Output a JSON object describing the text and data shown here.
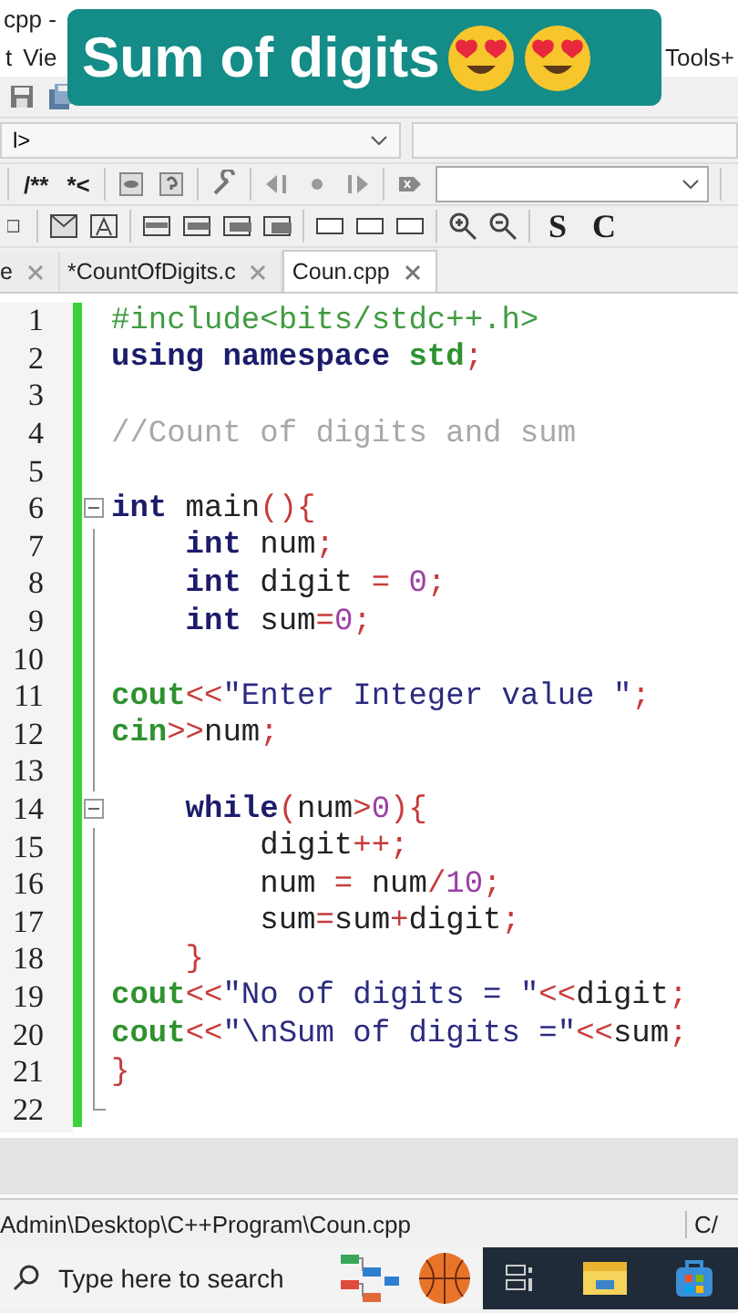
{
  "window": {
    "title": "cpp -"
  },
  "overlay_banner": {
    "title": "Sum of digits"
  },
  "menu": [
    "t",
    "Vie",
    "Tools+"
  ],
  "scope_combo": {
    "value": "l>"
  },
  "toolbar_labels": [
    "/**",
    "*<"
  ],
  "format_labels": [
    "S",
    "C"
  ],
  "tabs": [
    {
      "label": "e",
      "selected": false
    },
    {
      "label": "*CountOfDigits.c",
      "selected": false
    },
    {
      "label": "Coun.cpp",
      "selected": true
    }
  ],
  "editor": {
    "lines": [
      {
        "number": "1",
        "tokens": [
          {
            "kind": "pp",
            "t": "#include<bits/stdc++.h>"
          }
        ]
      },
      {
        "number": "2",
        "tokens": [
          {
            "kind": "kw",
            "t": "using namespace "
          },
          {
            "kind": "lib",
            "t": "std"
          },
          {
            "kind": "op",
            "t": ";"
          }
        ]
      },
      {
        "number": "3"
      },
      {
        "number": "4",
        "tokens": [
          {
            "kind": "comment",
            "t": "//Count of digits and sum"
          }
        ]
      },
      {
        "number": "5"
      },
      {
        "number": "6",
        "expanded": true,
        "tokens": [
          {
            "kind": "kw",
            "t": "int"
          },
          {
            "kind": "id",
            "t": " main"
          },
          {
            "kind": "op",
            "t": "(){"
          }
        ]
      },
      {
        "number": "7",
        "tokens": [
          {
            "kind": "kw",
            "t": "    int"
          },
          {
            "kind": "id",
            "t": " num"
          },
          {
            "kind": "op",
            "t": ";"
          }
        ]
      },
      {
        "number": "8",
        "tokens": [
          {
            "kind": "kw",
            "t": "    int"
          },
          {
            "kind": "id",
            "t": " digit "
          },
          {
            "kind": "op",
            "t": "= "
          },
          {
            "kind": "num",
            "t": "0"
          },
          {
            "kind": "op",
            "t": ";"
          }
        ]
      },
      {
        "number": "9",
        "tokens": [
          {
            "kind": "kw",
            "t": "    int"
          },
          {
            "kind": "id",
            "t": " sum"
          },
          {
            "kind": "op",
            "t": "="
          },
          {
            "kind": "num",
            "t": "0"
          },
          {
            "kind": "op",
            "t": ";"
          }
        ]
      },
      {
        "number": "10"
      },
      {
        "number": "11",
        "tokens": [
          {
            "kind": "lib",
            "t": "cout"
          },
          {
            "kind": "op",
            "t": "<<"
          },
          {
            "kind": "str",
            "t": "\"Enter Integer value \""
          },
          {
            "kind": "op",
            "t": ";"
          }
        ]
      },
      {
        "number": "12",
        "tokens": [
          {
            "kind": "lib",
            "t": "cin"
          },
          {
            "kind": "op",
            "t": ">>"
          },
          {
            "kind": "id",
            "t": "num"
          },
          {
            "kind": "op",
            "t": ";"
          }
        ]
      },
      {
        "number": "13"
      },
      {
        "number": "14",
        "expanded": true,
        "tokens": [
          {
            "kind": "kw",
            "t": "    while"
          },
          {
            "kind": "op",
            "t": "("
          },
          {
            "kind": "id",
            "t": "num"
          },
          {
            "kind": "op",
            "t": ">"
          },
          {
            "kind": "num",
            "t": "0"
          },
          {
            "kind": "op",
            "t": "){"
          }
        ]
      },
      {
        "number": "15",
        "tokens": [
          {
            "kind": "id",
            "t": "        digit"
          },
          {
            "kind": "op",
            "t": "++;"
          }
        ]
      },
      {
        "number": "16",
        "tokens": [
          {
            "kind": "id",
            "t": "        num "
          },
          {
            "kind": "op",
            "t": "= "
          },
          {
            "kind": "id",
            "t": "num"
          },
          {
            "kind": "op",
            "t": "/"
          },
          {
            "kind": "num",
            "t": "10"
          },
          {
            "kind": "op",
            "t": ";"
          }
        ]
      },
      {
        "number": "17",
        "tokens": [
          {
            "kind": "id",
            "t": "        sum"
          },
          {
            "kind": "op",
            "t": "="
          },
          {
            "kind": "id",
            "t": "sum"
          },
          {
            "kind": "op",
            "t": "+"
          },
          {
            "kind": "id",
            "t": "digit"
          },
          {
            "kind": "op",
            "t": ";"
          }
        ]
      },
      {
        "number": "18",
        "tokens": [
          {
            "kind": "op",
            "t": "    }"
          }
        ]
      },
      {
        "number": "19",
        "tokens": [
          {
            "kind": "lib",
            "t": "cout"
          },
          {
            "kind": "op",
            "t": "<<"
          },
          {
            "kind": "str",
            "t": "\"No of digits = \""
          },
          {
            "kind": "op",
            "t": "<<"
          },
          {
            "kind": "id",
            "t": "digit"
          },
          {
            "kind": "op",
            "t": ";"
          }
        ]
      },
      {
        "number": "20",
        "tokens": [
          {
            "kind": "lib",
            "t": "cout"
          },
          {
            "kind": "op",
            "t": "<<"
          },
          {
            "kind": "str",
            "t": "\"\\nSum of digits =\""
          },
          {
            "kind": "op",
            "t": "<<"
          },
          {
            "kind": "id",
            "t": "sum"
          },
          {
            "kind": "op",
            "t": ";"
          }
        ]
      },
      {
        "number": "21",
        "tokens": [
          {
            "kind": "op",
            "t": "}"
          }
        ]
      },
      {
        "number": "22"
      }
    ]
  },
  "status_bar": {
    "path": "Admin\\Desktop\\C++Program\\Coun.cpp",
    "right": "C/"
  },
  "taskbar": {
    "search_placeholder": "Type here to search"
  }
}
